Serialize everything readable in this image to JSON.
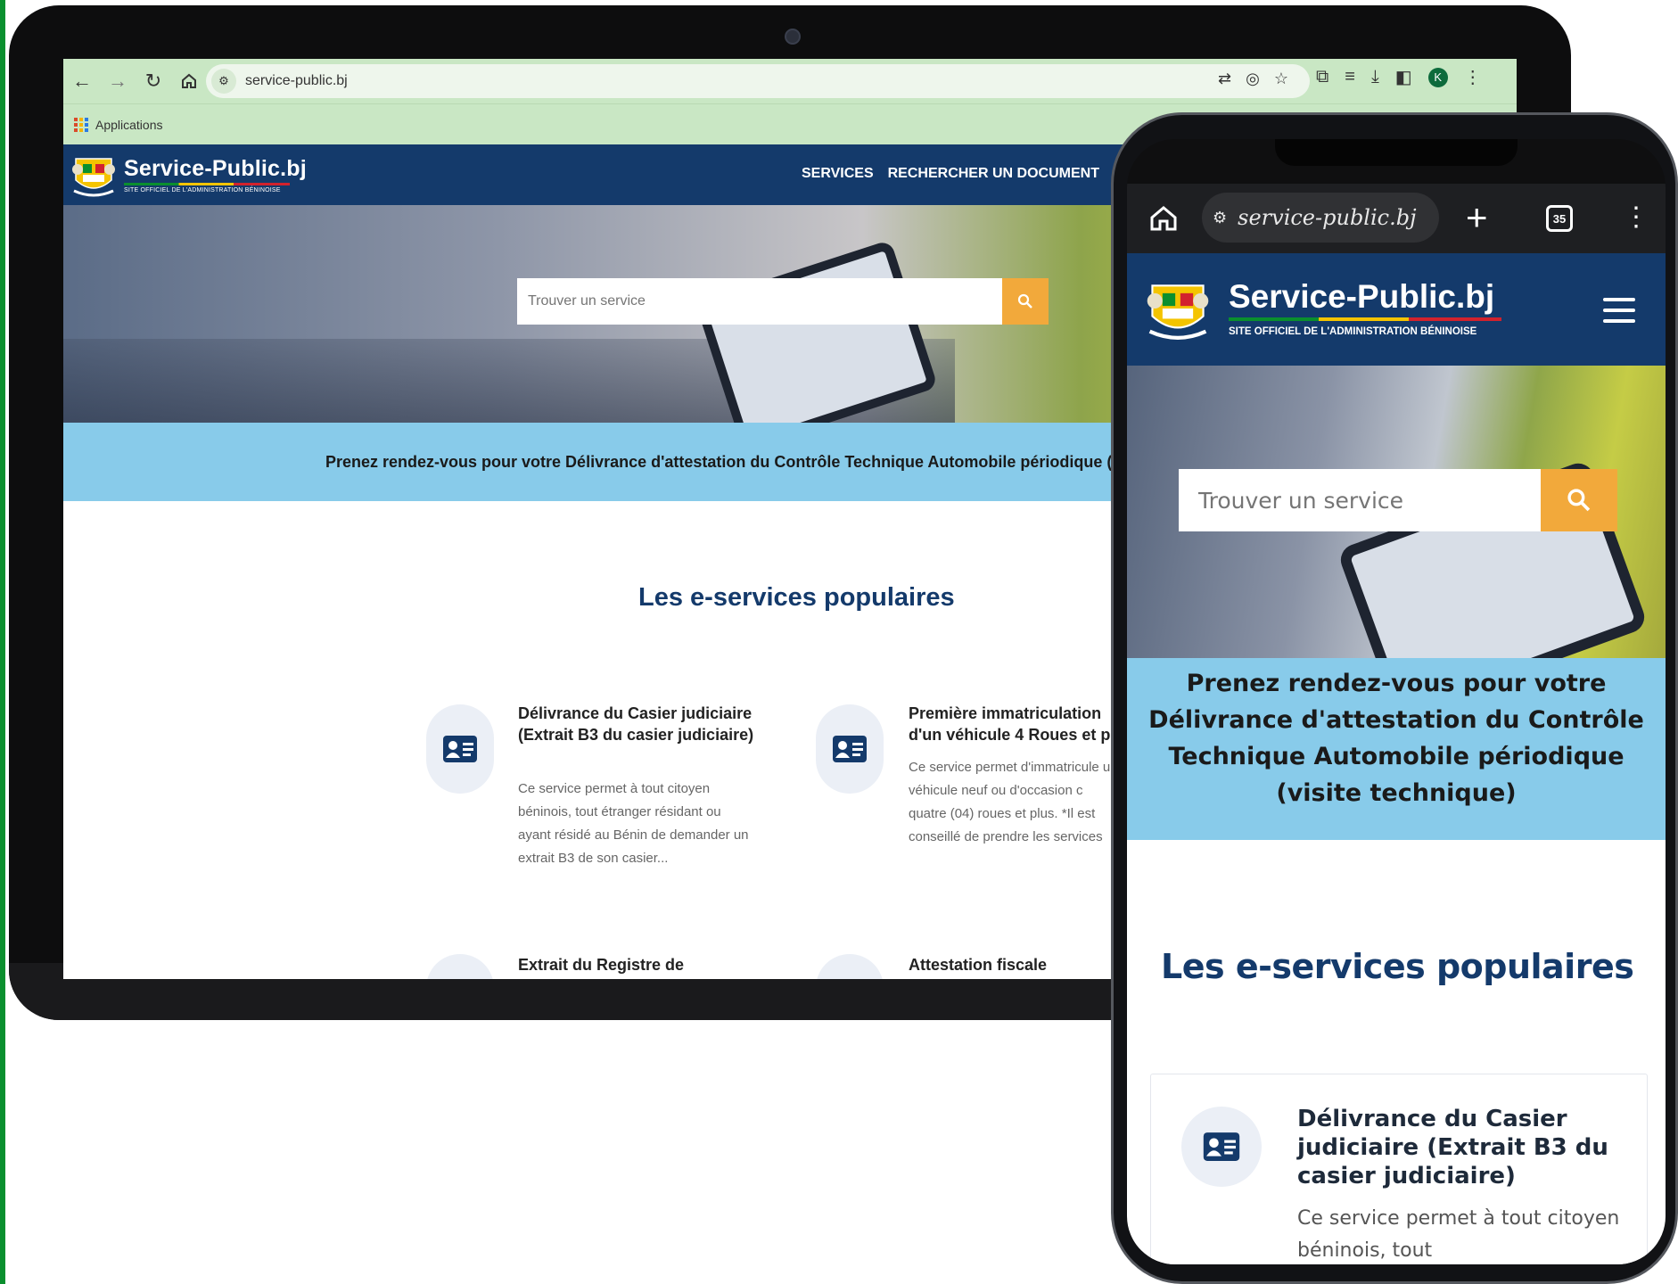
{
  "laptop": {
    "browser": {
      "url": "service-public.bj",
      "bookmarks": {
        "apps_label": "Applications"
      },
      "avatar_letter": "K"
    },
    "site": {
      "logo_title": "Service-Public.bj",
      "logo_subtitle": "SITE OFFICIEL DE L'ADMINISTRATION BÉNINOISE",
      "nav": {
        "services": "SERVICES",
        "search_document": "RECHERCHER UN DOCUMENT"
      },
      "search_placeholder": "Trouver un service",
      "banner": "Prenez rendez-vous pour votre Délivrance d'attestation du Contrôle Technique Automobile périodique (",
      "section_title": "Les e-services populaires",
      "cards": [
        {
          "title": "Délivrance du Casier judiciaire (Extrait B3 du casier judiciaire)",
          "description": "Ce service permet à tout citoyen béninois, tout étranger résidant ou ayant résidé au Bénin de demander un extrait B3 de son casier..."
        },
        {
          "title": "Première immatriculation d'un véhicule 4 Roues et pl",
          "description": "Ce service permet d'immatricule un véhicule neuf ou d'occasion c quatre (04) roues et plus. *Il est conseillé de prendre les services"
        },
        {
          "title": "Extrait du Registre de"
        },
        {
          "title": "Attestation fiscale"
        }
      ]
    }
  },
  "phone": {
    "browser": {
      "url": "service-public.bj",
      "tab_count": "35"
    },
    "site": {
      "logo_title": "Service-Public.bj",
      "logo_subtitle": "SITE OFFICIEL DE L'ADMINISTRATION BÉNINOISE",
      "search_placeholder": "Trouver un service",
      "banner": "Prenez rendez-vous pour votre Délivrance d'attestation du Contrôle Technique Automobile périodique (visite technique)",
      "section_title": "Les e-services populaires",
      "card": {
        "title": "Délivrance du Casier judiciaire (Extrait B3 du casier judiciaire)",
        "description": "Ce service permet à tout citoyen béninois, tout"
      }
    }
  },
  "colors": {
    "header_navy": "#143a6b",
    "search_orange": "#f2a93b",
    "banner_blue": "#88cbea",
    "chrome_green": "#c9e7c4",
    "edge_green": "#0a8f2e"
  }
}
